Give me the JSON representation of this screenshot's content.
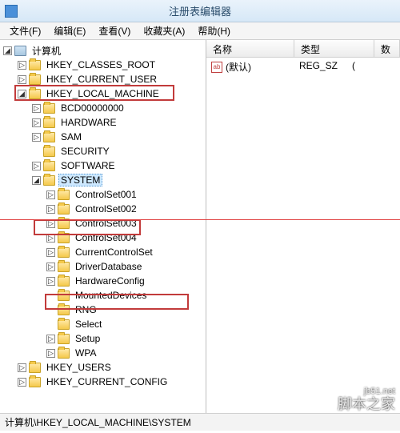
{
  "window": {
    "title": "注册表编辑器"
  },
  "menu": {
    "file": "文件(F)",
    "edit": "编辑(E)",
    "view": "查看(V)",
    "fav": "收藏夹(A)",
    "help": "帮助(H)"
  },
  "tree": {
    "root": "计算机",
    "hives": [
      "HKEY_CLASSES_ROOT",
      "HKEY_CURRENT_USER",
      "HKEY_LOCAL_MACHINE",
      "HKEY_USERS",
      "HKEY_CURRENT_CONFIG"
    ],
    "hklm": [
      "BCD00000000",
      "HARDWARE",
      "SAM",
      "SECURITY",
      "SOFTWARE",
      "SYSTEM"
    ],
    "system": [
      "ControlSet001",
      "ControlSet002",
      "ControlSet003",
      "ControlSet004",
      "CurrentControlSet",
      "DriverDatabase",
      "HardwareConfig",
      "MountedDevices",
      "RNG",
      "Select",
      "Setup",
      "WPA"
    ]
  },
  "list": {
    "cols": {
      "name": "名称",
      "type": "类型",
      "data": "数"
    },
    "rows": [
      {
        "name": "(默认)",
        "type": "REG_SZ",
        "data": "("
      }
    ]
  },
  "status": {
    "path": "计算机\\HKEY_LOCAL_MACHINE\\SYSTEM"
  },
  "watermark": {
    "text": "脚本之家",
    "url": "jb51.net"
  },
  "glyph": {
    "expand": "▷",
    "collapse": "◢",
    "ab": "ab"
  }
}
